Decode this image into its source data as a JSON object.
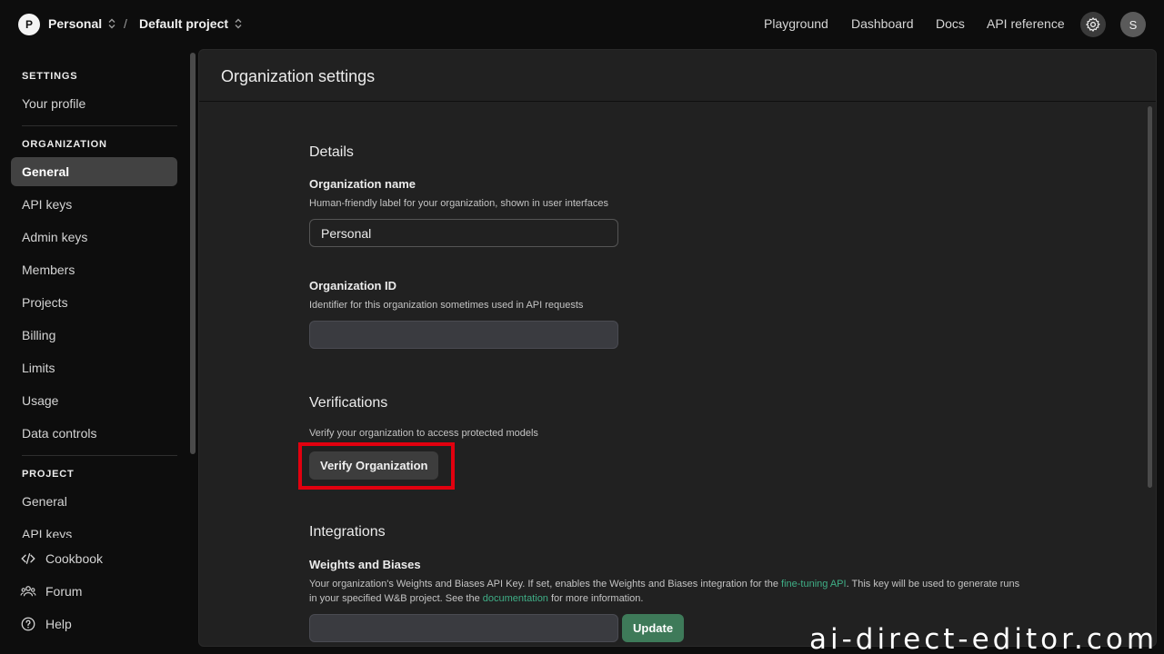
{
  "topbar": {
    "org_initial": "P",
    "org_name": "Personal",
    "separator": "/",
    "project_name": "Default project",
    "nav": [
      "Playground",
      "Dashboard",
      "Docs",
      "API reference"
    ],
    "user_initial": "S"
  },
  "sidebar": {
    "settings_label": "SETTINGS",
    "your_profile": "Your profile",
    "organization_label": "ORGANIZATION",
    "org_items": [
      "General",
      "API keys",
      "Admin keys",
      "Members",
      "Projects",
      "Billing",
      "Limits",
      "Usage",
      "Data controls"
    ],
    "active_item": "General",
    "project_label": "PROJECT",
    "project_items": [
      "General",
      "API keys"
    ],
    "bottom": [
      "Cookbook",
      "Forum",
      "Help"
    ]
  },
  "main": {
    "title": "Organization settings",
    "details": {
      "heading": "Details",
      "org_name_label": "Organization name",
      "org_name_help": "Human-friendly label for your organization, shown in user interfaces",
      "org_name_value": "Personal",
      "org_id_label": "Organization ID",
      "org_id_help": "Identifier for this organization sometimes used in API requests",
      "org_id_value": ""
    },
    "verifications": {
      "heading": "Verifications",
      "help": "Verify your organization to access protected models",
      "button": "Verify Organization"
    },
    "integrations": {
      "heading": "Integrations",
      "wandb_label": "Weights and Biases",
      "para_1": "Your organization's Weights and Biases API Key. If set, enables the Weights and Biases integration for the ",
      "link_1": "fine-tuning API",
      "para_2": ". This key will be used to generate runs in your specified W&B project. See the ",
      "link_2": "documentation",
      "para_3": " for more information.",
      "key_value": "",
      "update_button": "Update"
    }
  },
  "watermark": "ai-direct-editor.com",
  "colors": {
    "accent_link": "#3fae86",
    "update_button": "#3e7a59",
    "highlight_box": "#e2000f"
  }
}
